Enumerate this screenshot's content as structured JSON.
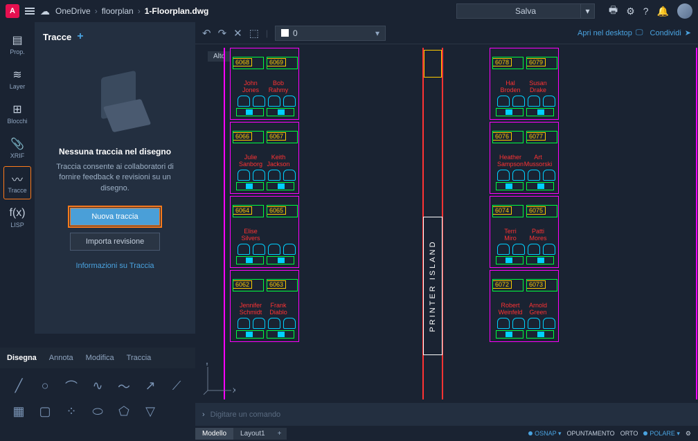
{
  "breadcrumb": {
    "root": "OneDrive",
    "folder": "floorplan",
    "file": "1-Floorplan.dwg"
  },
  "save_label": "Salva",
  "rail": [
    {
      "label": "Prop.",
      "icon": "▤"
    },
    {
      "label": "Layer",
      "icon": "≋"
    },
    {
      "label": "Blocchi",
      "icon": "⊞"
    },
    {
      "label": "XRIF",
      "icon": "📎"
    },
    {
      "label": "Tracce",
      "icon": "〰",
      "active": true
    },
    {
      "label": "LISP",
      "icon": "f(x)"
    }
  ],
  "panel": {
    "title": "Tracce",
    "h2": "Nessuna traccia nel disegno",
    "desc": "Traccia consente ai collaboratori di fornire feedback e revisioni su un disegno.",
    "btn_primary": "Nuova traccia",
    "btn_secondary": "Importa revisione",
    "link": "Informazioni su Traccia"
  },
  "tool_tabs": [
    "Disegna",
    "Annota",
    "Modifica",
    "Traccia"
  ],
  "canvas_bar": {
    "layer0": "0",
    "open_desktop": "Apri nel desktop",
    "share": "Condividi"
  },
  "view_label": "Alto",
  "printer_island": "PRINTER  ISLAND",
  "bays_left": [
    {
      "room1": "6068",
      "room2": "6069",
      "n1": "John Jones",
      "n2": "Bob Rahmy"
    },
    {
      "room1": "6066",
      "room2": "6067",
      "n1": "Julie Sanborg",
      "n2": "Keith Jackson"
    },
    {
      "room1": "6064",
      "room2": "6065",
      "n1": "Elise Silvers",
      "n2": ""
    },
    {
      "room1": "6062",
      "room2": "6063",
      "n1": "Jennifer Schmidt",
      "n2": "Frank Diablo"
    }
  ],
  "bays_right": [
    {
      "room1": "6078",
      "room2": "6079",
      "n1": "Hal Broden",
      "n2": "Susan Drake"
    },
    {
      "room1": "6076",
      "room2": "6077",
      "n1": "Heather Sampson",
      "n2": "Art Mussorski"
    },
    {
      "room1": "6074",
      "room2": "6075",
      "n1": "Terri Miro",
      "n2": "Patti Mores"
    },
    {
      "room1": "6072",
      "room2": "6073",
      "n1": "Robert Weinfeld",
      "n2": "Arnold Green"
    }
  ],
  "cmd_placeholder": "Digitare un comando",
  "bottom_tabs": [
    "Modello",
    "Layout1"
  ],
  "status": [
    {
      "label": "OSNAP",
      "on": true,
      "dd": true
    },
    {
      "label": "OPUNTAMENTO",
      "on": false
    },
    {
      "label": "ORTO",
      "on": false
    },
    {
      "label": "POLARE",
      "on": true,
      "dd": true
    }
  ]
}
